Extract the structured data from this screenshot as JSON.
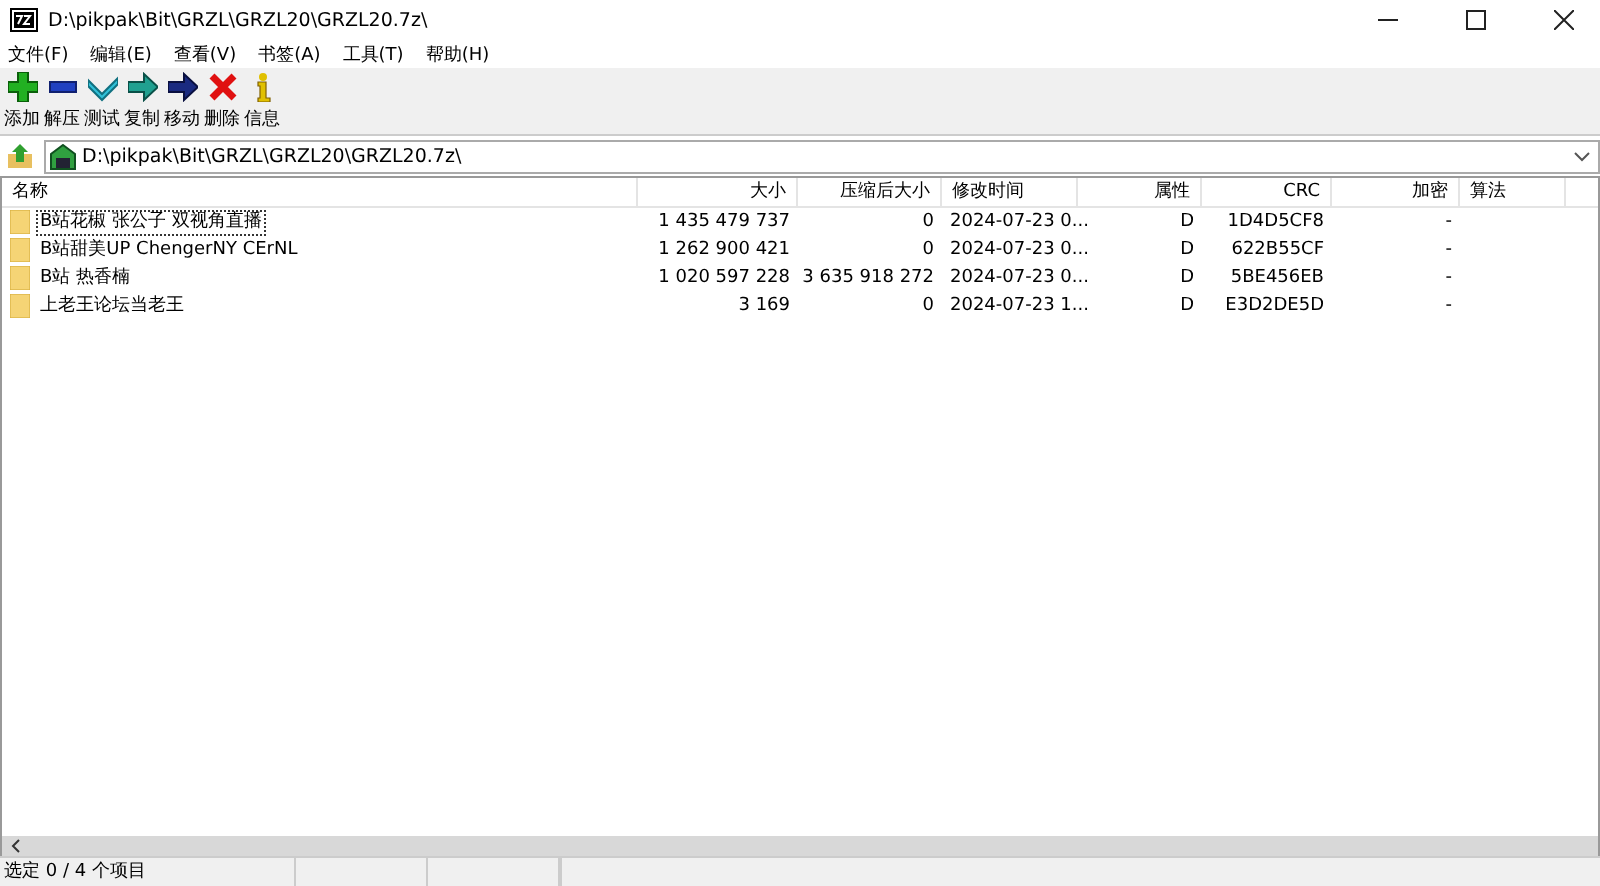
{
  "window": {
    "title": "D:\\pikpak\\Bit\\GRZL\\GRZL20\\GRZL20.7z\\"
  },
  "menu": [
    "文件(F)",
    "编辑(E)",
    "查看(V)",
    "书签(A)",
    "工具(T)",
    "帮助(H)"
  ],
  "toolbar": [
    {
      "label": "添加",
      "kind": "add"
    },
    {
      "label": "解压",
      "kind": "extract"
    },
    {
      "label": "测试",
      "kind": "test"
    },
    {
      "label": "复制",
      "kind": "copy"
    },
    {
      "label": "移动",
      "kind": "move"
    },
    {
      "label": "删除",
      "kind": "delete"
    },
    {
      "label": "信息",
      "kind": "info"
    }
  ],
  "address": {
    "value": "D:\\pikpak\\Bit\\GRZL\\GRZL20\\GRZL20.7z\\"
  },
  "table": {
    "columns": [
      "名称",
      "大小",
      "压缩后大小",
      "修改时间",
      "属性",
      "CRC",
      "加密",
      "算法"
    ],
    "rows": [
      {
        "cells": [
          "B站花椒 张公子 双视角直播",
          "1 435 479 737",
          "0",
          "2024-07-23 0...",
          "D",
          "1D4D5CF8",
          "-",
          ""
        ],
        "focused": true
      },
      {
        "cells": [
          "B站甜美UP ChengerNY CErNL",
          "1 262 900 421",
          "0",
          "2024-07-23 0...",
          "D",
          "622B55CF",
          "-",
          ""
        ],
        "focused": false
      },
      {
        "cells": [
          "B站 热香楠",
          "1 020 597 228",
          "3 635 918 272",
          "2024-07-23 0...",
          "D",
          "5BE456EB",
          "-",
          ""
        ],
        "focused": false
      },
      {
        "cells": [
          "上老王论坛当老王",
          "3 169",
          "0",
          "2024-07-23 1...",
          "D",
          "E3D2DE5D",
          "-",
          ""
        ],
        "focused": false
      }
    ]
  },
  "status_bar": {
    "text": "选定 0 / 4 个项目"
  }
}
